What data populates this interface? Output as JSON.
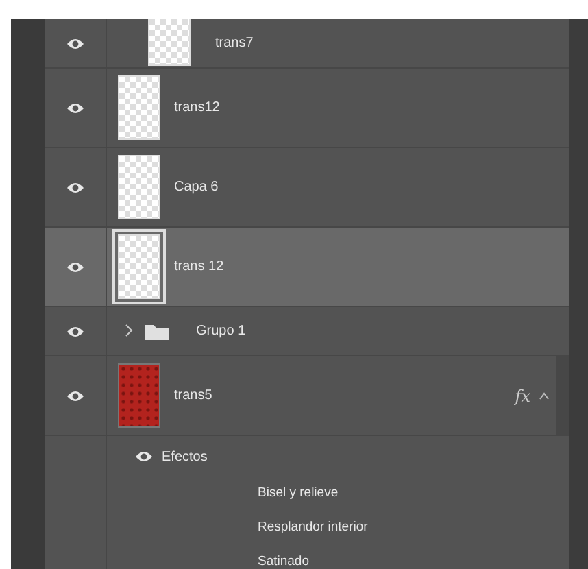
{
  "layers": [
    {
      "kind": "layer",
      "name": "trans7",
      "visible": true,
      "selected": false,
      "clipped": true
    },
    {
      "kind": "layer",
      "name": "trans12",
      "visible": true,
      "selected": false,
      "clipped": false
    },
    {
      "kind": "layer",
      "name": "Capa 6",
      "visible": true,
      "selected": false,
      "clipped": false
    },
    {
      "kind": "layer",
      "name": "trans 12",
      "visible": true,
      "selected": true,
      "clipped": false
    },
    {
      "kind": "group",
      "name": "Grupo 1",
      "visible": true,
      "selected": false,
      "expanded": false
    },
    {
      "kind": "texture",
      "name": "trans5",
      "visible": true,
      "selected": false,
      "clipped": false,
      "fx": "fx",
      "expanded": true,
      "effects": {
        "label": "Efectos",
        "visible": true,
        "children": [
          {
            "name": "Bisel y relieve"
          },
          {
            "name": "Resplandor interior"
          },
          {
            "name": "Satinado"
          }
        ]
      }
    }
  ]
}
